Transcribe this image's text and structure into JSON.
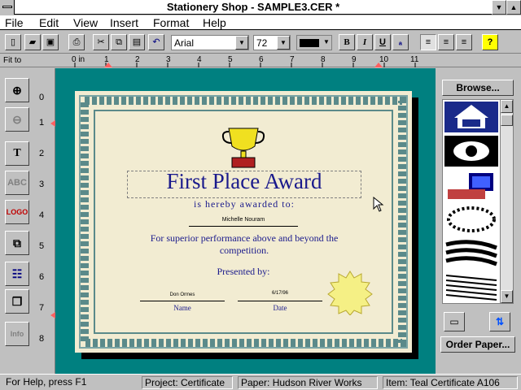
{
  "window": {
    "title": "Stationery Shop - SAMPLE3.CER *"
  },
  "menu": [
    "File",
    "Edit",
    "View",
    "Insert",
    "Format",
    "Help"
  ],
  "toolbar": {
    "font": "Arial",
    "size": "72"
  },
  "ruler": {
    "label": "Fit to",
    "ticks": [
      "0 in",
      "1",
      "2",
      "3",
      "4",
      "5",
      "6",
      "7",
      "8",
      "9",
      "10",
      "11"
    ]
  },
  "vruler": [
    "0",
    "1",
    "2",
    "3",
    "4",
    "5",
    "6",
    "7",
    "8"
  ],
  "certificate": {
    "title": "First Place Award",
    "awarded": "is hereby awarded to:",
    "recipient": "Michelle Nouram",
    "reason": "For superior performance above and beyond the competition.",
    "presented": "Presented by:",
    "presenter": "Don Ormes",
    "date_value": "6/17/96",
    "name_label": "Name",
    "date_label": "Date"
  },
  "sidebar": {
    "browse": "Browse...",
    "order": "Order Paper..."
  },
  "status": {
    "help": "For Help, press F1",
    "project": "Project: Certificate",
    "paper": "Paper: Hudson River Works",
    "item": "Item: Teal Certificate A106"
  },
  "colors": {
    "teal": "#008080",
    "paper": "#f2ecd2",
    "border": "#5b8a8a",
    "text": "#1a1a8c",
    "gold": "#f5f085"
  }
}
